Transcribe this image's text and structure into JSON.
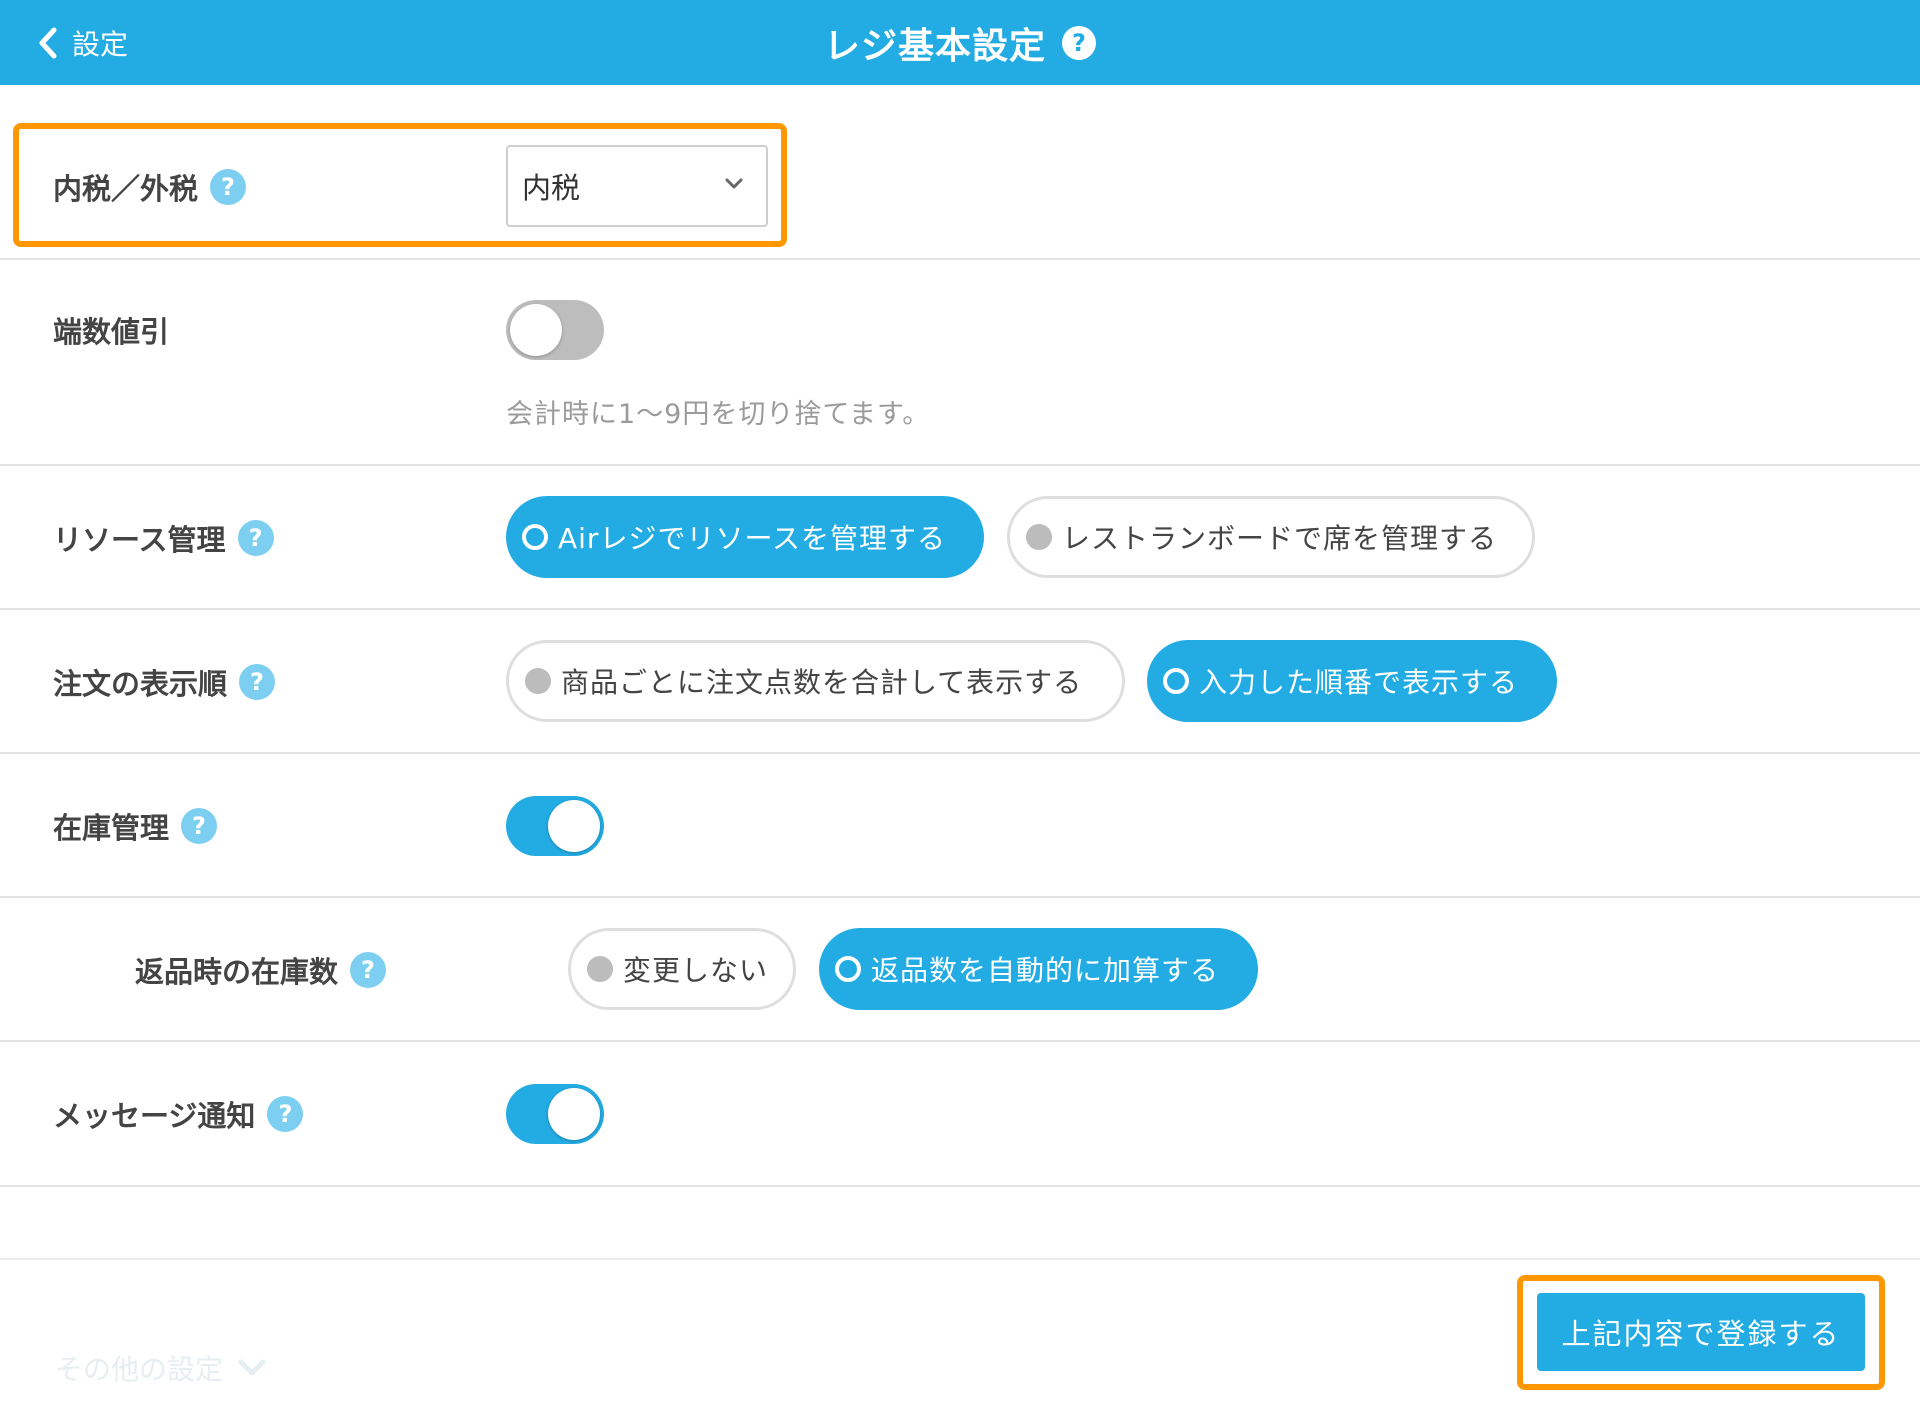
{
  "header": {
    "back_label": "設定",
    "title": "レジ基本設定",
    "help": "?"
  },
  "colors": {
    "primary": "#22ace3",
    "help_light": "#7dcff1",
    "highlight": "#ff9700",
    "toggle_off": "#bdbdbd"
  },
  "settings": {
    "tax": {
      "label": "内税／外税",
      "help": "?",
      "selected": "内税"
    },
    "rounding": {
      "label": "端数値引",
      "enabled": false,
      "note": "会計時に1〜9円を切り捨てます。"
    },
    "resource": {
      "label": "リソース管理",
      "help": "?",
      "options": [
        "Airレジでリソースを管理する",
        "レストランボードで席を管理する"
      ],
      "selected_index": 0
    },
    "order_display": {
      "label": "注文の表示順",
      "help": "?",
      "options": [
        "商品ごとに注文点数を合計して表示する",
        "入力した順番で表示する"
      ],
      "selected_index": 1
    },
    "inventory": {
      "label": "在庫管理",
      "help": "?",
      "enabled": true
    },
    "return_stock": {
      "label": "返品時の在庫数",
      "help": "?",
      "options": [
        "変更しない",
        "返品数を自動的に加算する"
      ],
      "selected_index": 1
    },
    "message": {
      "label": "メッセージ通知",
      "help": "?",
      "enabled": true
    }
  },
  "footer": {
    "other_settings": "その他の設定",
    "submit_label": "上記内容で登録する"
  }
}
